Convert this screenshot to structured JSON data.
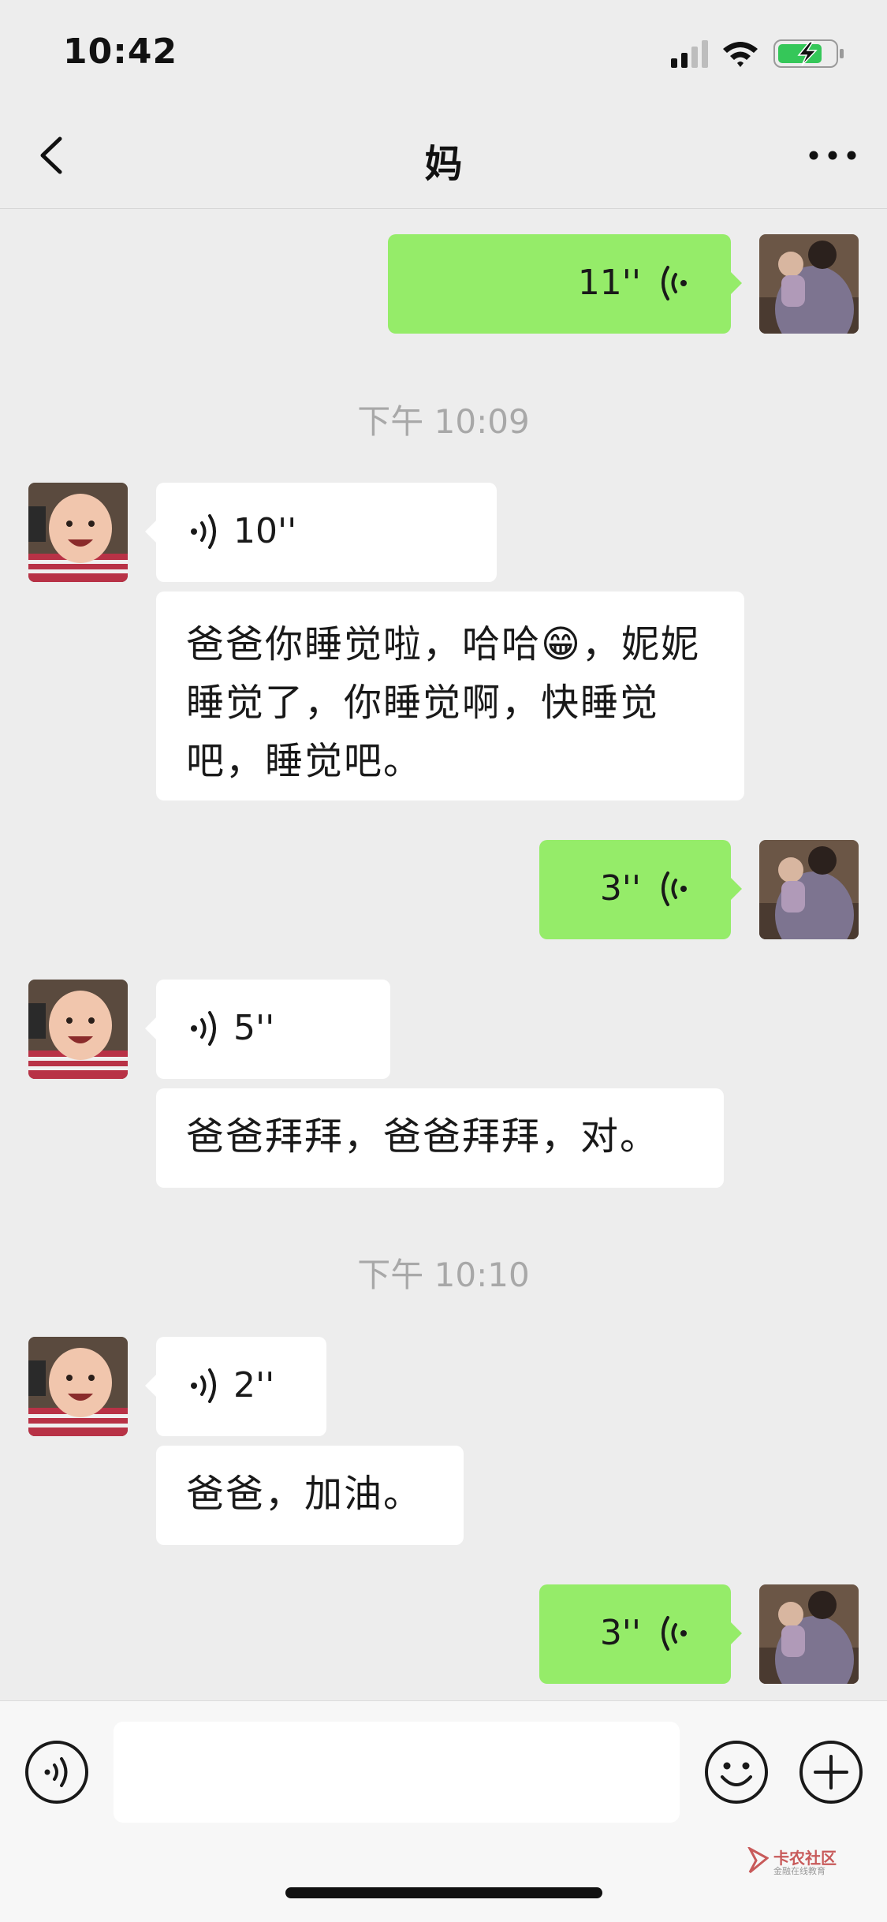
{
  "status_bar": {
    "time": "10:42"
  },
  "header": {
    "title": "妈",
    "back_icon": "chevron-left-icon",
    "more_icon": "more-dots-icon"
  },
  "messages": {
    "m1": {
      "direction": "outgoing",
      "type": "voice",
      "duration": "11''"
    },
    "t1": {
      "type": "timestamp",
      "text": "下午 10:09"
    },
    "m2": {
      "direction": "incoming",
      "type": "voice",
      "duration": "10''"
    },
    "m3": {
      "direction": "incoming",
      "type": "text",
      "text": "爸爸你睡觉啦，哈哈😁，妮妮睡觉了，你睡觉啊，快睡觉吧，睡觉吧。"
    },
    "m4": {
      "direction": "outgoing",
      "type": "voice",
      "duration": "3''"
    },
    "m5": {
      "direction": "incoming",
      "type": "voice",
      "duration": "5''"
    },
    "m6": {
      "direction": "incoming",
      "type": "text",
      "text": "爸爸拜拜，爸爸拜拜，对。"
    },
    "t2": {
      "type": "timestamp",
      "text": "下午 10:10"
    },
    "m7": {
      "direction": "incoming",
      "type": "voice",
      "duration": "2''"
    },
    "m8": {
      "direction": "incoming",
      "type": "text",
      "text": "爸爸，加油。"
    },
    "m9": {
      "direction": "outgoing",
      "type": "voice",
      "duration": "3''"
    }
  },
  "input_bar": {
    "text_value": "",
    "voice_icon": "voice-input-icon",
    "emoji_icon": "emoji-icon",
    "plus_icon": "plus-icon"
  },
  "watermark": {
    "title": "卡农社区",
    "subtitle": "金融在线教育"
  },
  "colors": {
    "background": "#ededed",
    "outgoing_bubble": "#95ec69",
    "incoming_bubble": "#ffffff",
    "timestamp_text": "#a8a8a8"
  }
}
